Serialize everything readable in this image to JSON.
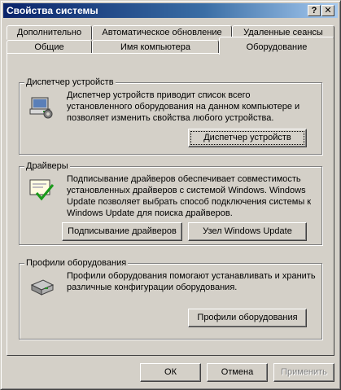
{
  "window": {
    "title": "Свойства системы"
  },
  "titlebar_buttons": {
    "help": "?",
    "close": "✕"
  },
  "tabs": {
    "row_back": [
      "Дополнительно",
      "Автоматическое обновление",
      "Удаленные сеансы"
    ],
    "row_front": [
      "Общие",
      "Имя компьютера",
      "Оборудование"
    ],
    "active": "Оборудование"
  },
  "device_manager": {
    "legend": "Диспетчер устройств",
    "description": "Диспетчер устройств приводит список всего установленного оборудования на данном компьютере и позволяет изменить свойства любого устройства.",
    "button": "Диспетчер устройств",
    "icon": "device-manager-icon"
  },
  "drivers": {
    "legend": "Драйверы",
    "description": "Подписывание драйверов обеспечивает совместимость установленных драйверов с системой Windows.  Windows Update позволяет выбрать способ подключения системы к Windows Update для поиска драйверов.",
    "signing_button": "Подписывание драйверов",
    "windows_update_button": "Узел Windows Update",
    "icon": "driver-certificate-icon"
  },
  "hardware_profiles": {
    "legend": "Профили оборудования",
    "description": "Профили оборудования помогают устанавливать и хранить различные конфигурации оборудования.",
    "button": "Профили оборудования",
    "icon": "hardware-profile-icon"
  },
  "footer": {
    "ok": "ОК",
    "cancel": "Отмена",
    "apply": "Применить",
    "apply_enabled": false
  }
}
